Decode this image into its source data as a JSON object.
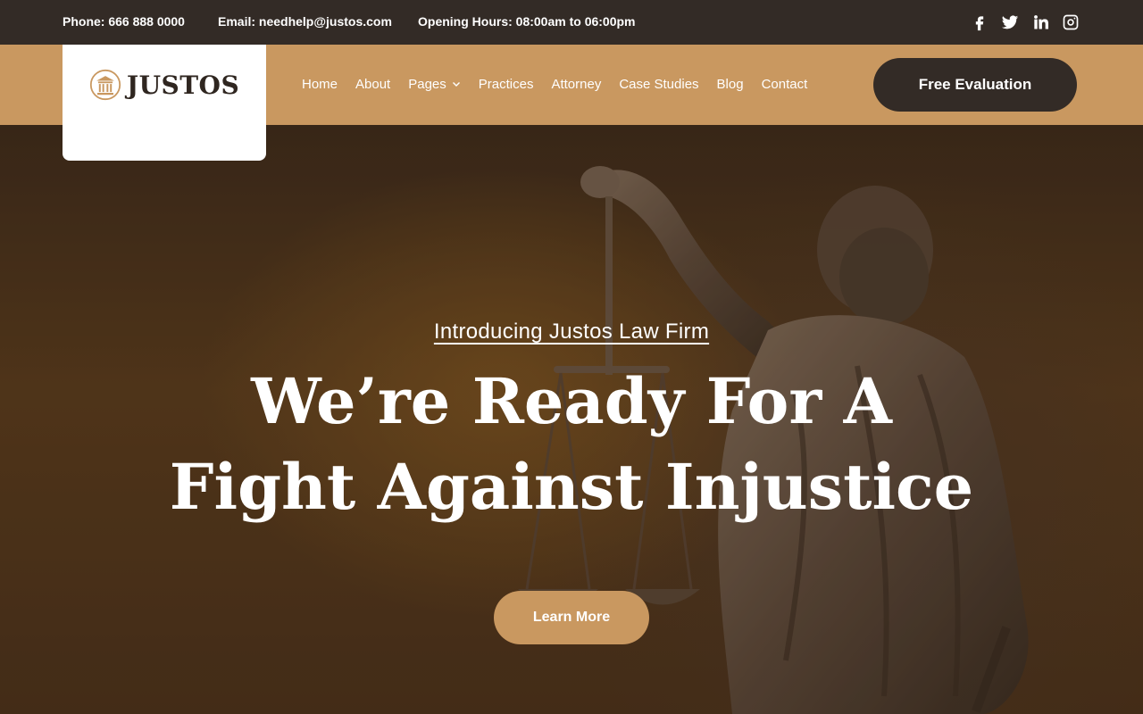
{
  "topbar": {
    "phone": "Phone: 666 888 0000",
    "email": "Email: needhelp@justos.com",
    "hours": "Opening Hours: 08:00am to 06:00pm",
    "social": [
      "facebook-icon",
      "twitter-icon",
      "linkedin-icon",
      "instagram-icon"
    ]
  },
  "brand": {
    "name": "JUSTOS"
  },
  "nav": {
    "items": [
      "Home",
      "About",
      "Pages",
      "Practices",
      "Attorney",
      "Case Studies",
      "Blog",
      "Contact"
    ],
    "cta": "Free Evaluation"
  },
  "hero": {
    "kicker": "Introducing Justos Law Firm",
    "title_line1": "We’re Ready For A",
    "title_line2": "Fight Against Injustice",
    "cta": "Learn More"
  },
  "colors": {
    "accent": "#c99860",
    "dark": "#332b26",
    "white": "#ffffff"
  }
}
